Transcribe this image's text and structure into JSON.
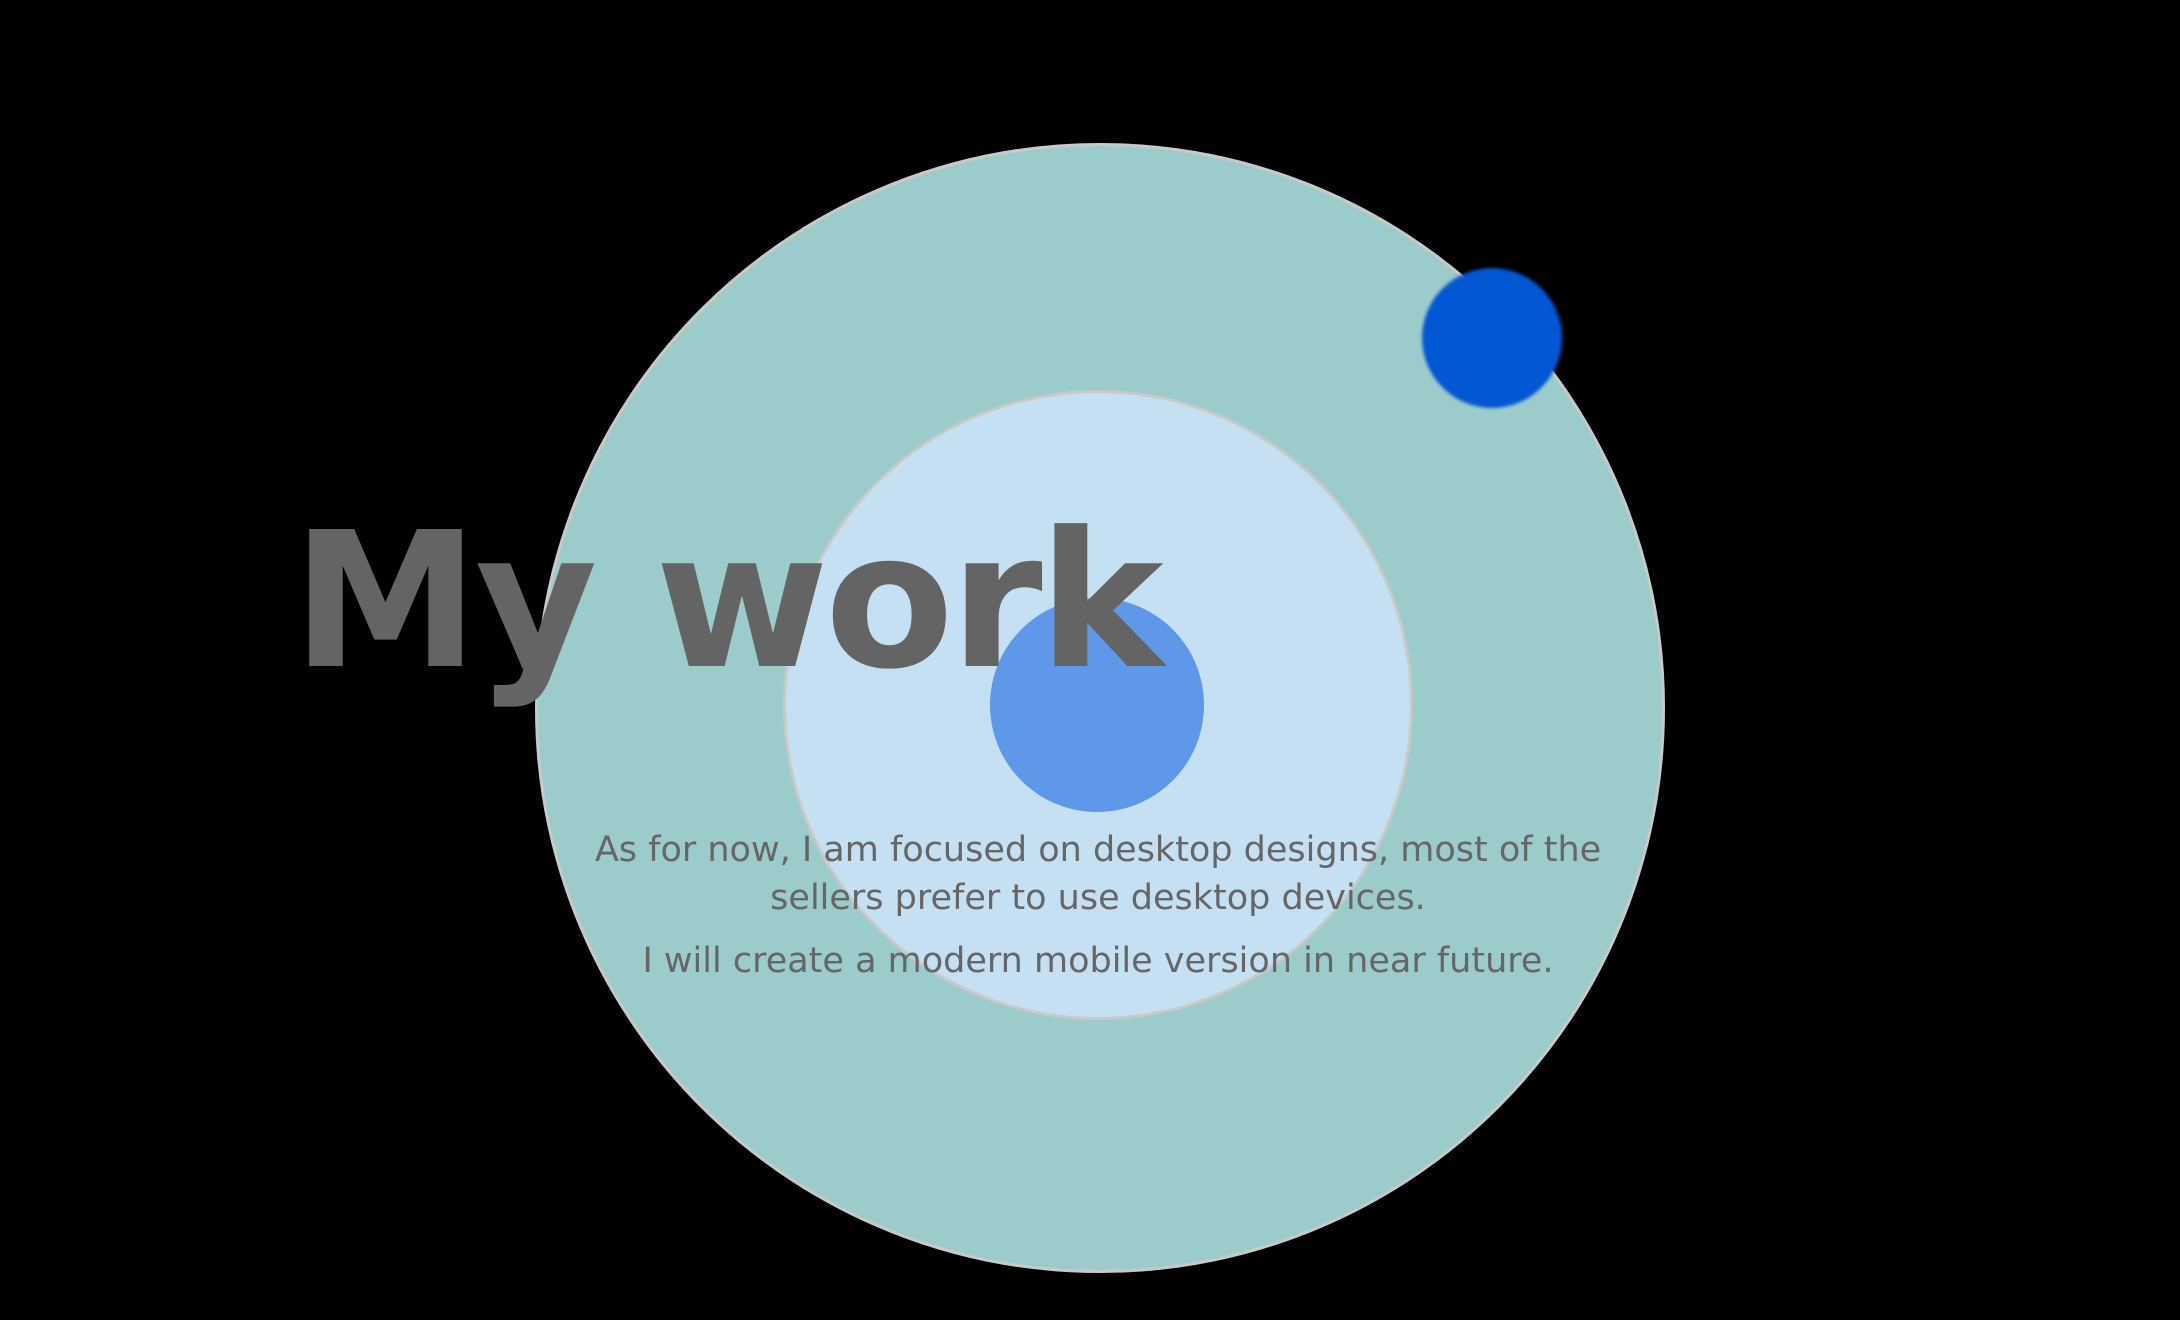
{
  "section": {
    "title": "My work",
    "paragraphs": [
      "As for now, I am focused on desktop designs, most of the sellers prefer to use desktop devices.",
      "I will create a modern mobile version in near future."
    ]
  },
  "colors": {
    "background": "#000000",
    "outer_ring": "#9ccbcc",
    "inner_ring": "#c5e0f3",
    "center_dot": "#5f98e8",
    "orbit_dot": "#0257d3",
    "ring_border": "#c9c9c9",
    "text": "#646464"
  }
}
